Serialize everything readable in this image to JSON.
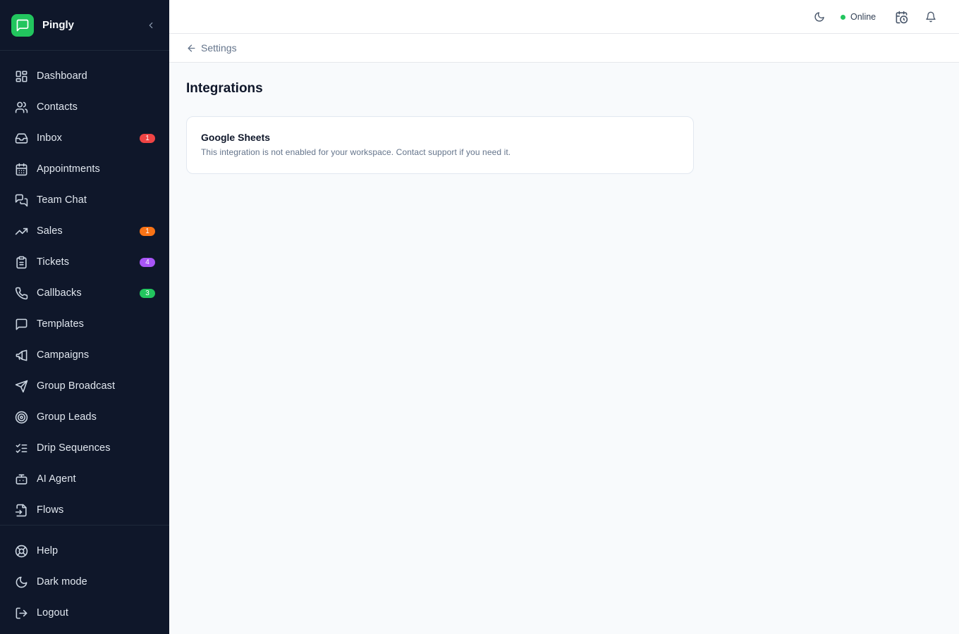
{
  "app": {
    "name": "Pingly"
  },
  "colors": {
    "sidebar_bg": "#0f172a",
    "brand": "#22c55e",
    "badge_red": "#ef4444",
    "badge_orange": "#f97316",
    "badge_purple": "#a855f7",
    "badge_green": "#22c55e"
  },
  "sidebar": {
    "items": [
      {
        "label": "Dashboard",
        "icon": "dashboard-icon"
      },
      {
        "label": "Contacts",
        "icon": "users-icon"
      },
      {
        "label": "Inbox",
        "icon": "inbox-icon",
        "badge": "1"
      },
      {
        "label": "Appointments",
        "icon": "calendar-icon"
      },
      {
        "label": "Team Chat",
        "icon": "chat-icon"
      },
      {
        "label": "Sales",
        "icon": "trending-up-icon",
        "badge": "1"
      },
      {
        "label": "Tickets",
        "icon": "clipboard-icon",
        "badge": "4"
      },
      {
        "label": "Callbacks",
        "icon": "phone-icon",
        "badge": "3"
      },
      {
        "label": "Templates",
        "icon": "message-square-icon"
      },
      {
        "label": "Campaigns",
        "icon": "megaphone-icon"
      },
      {
        "label": "Group Broadcast",
        "icon": "send-icon"
      },
      {
        "label": "Group Leads",
        "icon": "target-icon"
      },
      {
        "label": "Drip Sequences",
        "icon": "list-checks-icon"
      },
      {
        "label": "AI Agent",
        "icon": "bot-icon"
      },
      {
        "label": "Flows",
        "icon": "flow-file-icon"
      }
    ],
    "footer": [
      {
        "label": "Help",
        "icon": "lifebuoy-icon"
      },
      {
        "label": "Dark mode",
        "icon": "moon-icon"
      },
      {
        "label": "Logout",
        "icon": "logout-icon"
      }
    ]
  },
  "topbar": {
    "status": "Online"
  },
  "breadcrumb": {
    "back_label": "Settings"
  },
  "main": {
    "title": "Integrations",
    "card": {
      "title": "Google Sheets",
      "description": "This integration is not enabled for your workspace. Contact support if you need it."
    }
  }
}
